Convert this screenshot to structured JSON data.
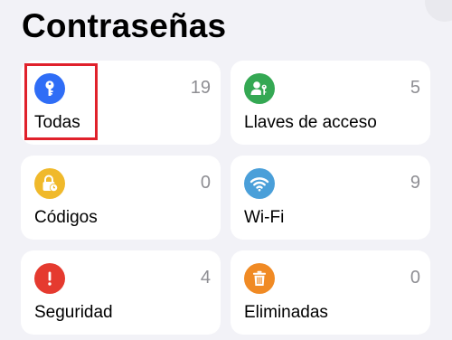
{
  "header": {
    "title": "Contraseñas"
  },
  "categories": [
    {
      "label": "Todas",
      "count": "19",
      "icon": "key-icon",
      "color": "#2f6df6"
    },
    {
      "label": "Llaves de acceso",
      "count": "5",
      "icon": "person-key-icon",
      "color": "#34a853"
    },
    {
      "label": "Códigos",
      "count": "0",
      "icon": "lock-clock-icon",
      "color": "#f0b92b"
    },
    {
      "label": "Wi-Fi",
      "count": "9",
      "icon": "wifi-icon",
      "color": "#4a9fd9"
    },
    {
      "label": "Seguridad",
      "count": "4",
      "icon": "exclamation-icon",
      "color": "#e53a2f"
    },
    {
      "label": "Eliminadas",
      "count": "0",
      "icon": "trash-icon",
      "color": "#f08a24"
    }
  ],
  "highlight": {
    "target": "Todas",
    "color": "#e0212b"
  }
}
